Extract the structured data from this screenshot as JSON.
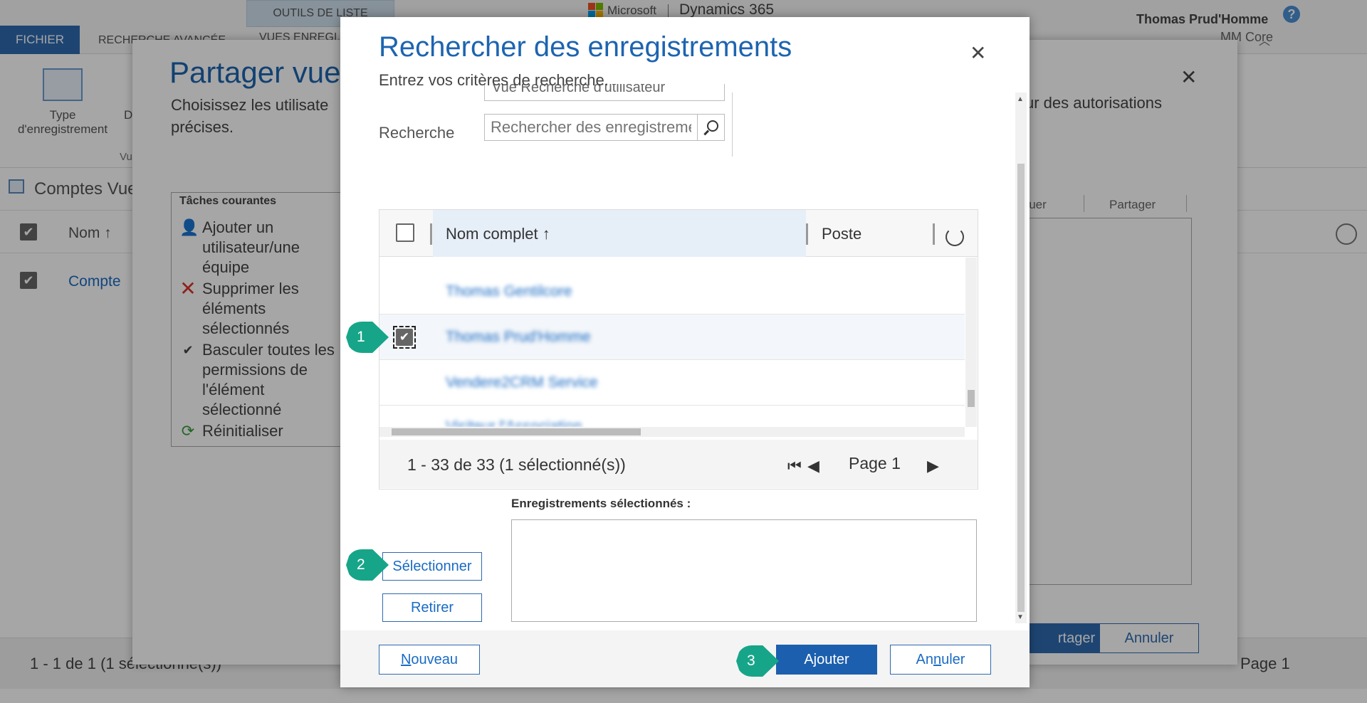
{
  "app": {
    "tab_file": "FICHIER",
    "tab_advanced_search": "RECHERCHE AVANCÉE",
    "tools_header": "OUTILS DE LISTE",
    "tab_views": "VUES ENREGI...",
    "brand": "Microsoft",
    "product": "Dynamics 365",
    "user_name": "Thomas Prud'Homme",
    "org_name": "MM Core",
    "ribbon_type_label": "Type d'enregistrement",
    "ribbon_d": "D",
    "ribbon_group": "Vu",
    "view_title": "Comptes Vue",
    "col_nom": "Nom ↑",
    "row_link": "Compte",
    "footer_count": "1 - 1  de 1 (1 sélectionné(s))",
    "footer_page": "Page 1"
  },
  "share": {
    "title": "Partager vue",
    "desc_left_1": "Choisissez les utilisate",
    "desc_left_2": "précises.",
    "desc_right": "ur des autorisations",
    "tasks_title": "Tâches courantes",
    "tasks": [
      {
        "label_lines": [
          "Ajouter un",
          "utilisateur/une",
          "équipe"
        ]
      },
      {
        "label_lines": [
          "Supprimer les",
          "éléments",
          "sélectionnés"
        ]
      },
      {
        "label_lines": [
          "Basculer toutes les",
          "permissions de",
          "l'élément",
          "sélectionné"
        ]
      },
      {
        "label_lines": [
          "Réinitialiser"
        ]
      }
    ],
    "col_attribuer": "ibuer",
    "col_partager": "Partager",
    "ok_label": "rtager",
    "cancel_label": "Annuler"
  },
  "lookup": {
    "title": "Rechercher des enregistrements",
    "subtitle": "Entrez vos critères de recherche.",
    "dans_value": "Vue Recherche d'utilisateur",
    "search_label": "Recherche",
    "search_placeholder": "Rechercher des enregistrements",
    "col_fullname": "Nom complet ↑",
    "col_position": "Poste",
    "rows": [
      {
        "name": "Thomas Gentilcore"
      },
      {
        "name": "Thomas Prud'Homme"
      },
      {
        "name": "Vendere2CRM Service"
      },
      {
        "name": "Visiteur l'Association"
      }
    ],
    "count": "1 - 33  de 33 (1 sélectionné(s))",
    "page": "Page 1",
    "selected_label": "Enregistrements sélectionnés :",
    "select_btn": "Sélectionner",
    "remove_btn": "Retirer",
    "new_btn_first": "N",
    "new_btn_rest": "ouveau",
    "add_btn": "Ajouter",
    "cancel_btn_pre": "An",
    "cancel_btn_u": "n",
    "cancel_btn_post": "uler"
  },
  "callouts": {
    "one": "1",
    "two": "2",
    "three": "3"
  }
}
